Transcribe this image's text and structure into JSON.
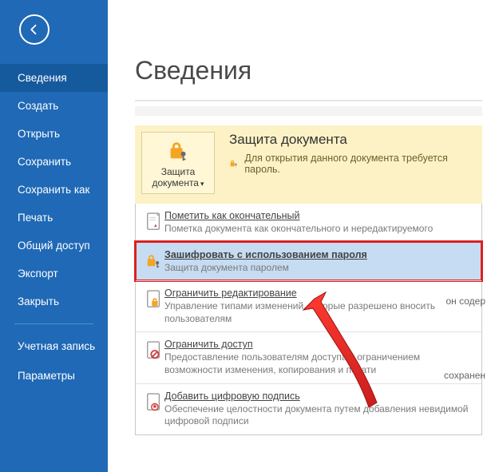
{
  "sidebar": {
    "items": [
      {
        "label": "Сведения",
        "active": true
      },
      {
        "label": "Создать"
      },
      {
        "label": "Открыть"
      },
      {
        "label": "Сохранить"
      },
      {
        "label": "Сохранить как"
      },
      {
        "label": "Печать"
      },
      {
        "label": "Общий доступ"
      },
      {
        "label": "Экспорт"
      },
      {
        "label": "Закрыть"
      }
    ],
    "footer": [
      {
        "label": "Учетная запись"
      },
      {
        "label": "Параметры"
      }
    ]
  },
  "page": {
    "title": "Сведения"
  },
  "protect": {
    "button_label": "Защита документа",
    "heading": "Защита документа",
    "note": "Для открытия данного документа требуется пароль."
  },
  "dropdown": [
    {
      "title": "Пометить как окончательный",
      "desc": "Пометка документа как окончательного и нередактируемого"
    },
    {
      "title": "Зашифровать с использованием пароля",
      "desc": "Защита документа паролем",
      "highlighted": true
    },
    {
      "title": "Ограничить редактирование",
      "desc": "Управление типами изменений, которые разрешено вносить пользователям"
    },
    {
      "title": "Ограничить доступ",
      "desc": "Предоставление пользователям доступа с ограничением возможности изменения, копирования и печати"
    },
    {
      "title": "Добавить цифровую подпись",
      "desc": "Обеспечение целостности документа путем добавления невидимой цифровой подписи"
    }
  ],
  "aside": {
    "contains": "он содер",
    "saved": "сохранен"
  }
}
